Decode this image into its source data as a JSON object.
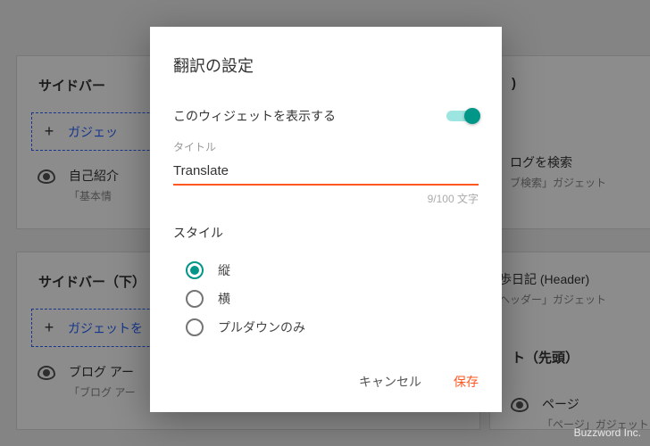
{
  "bg": {
    "left_top_title": "サイドバー",
    "left_bot_title": "サイドバー（下）",
    "add_gadget": "ガジェッ",
    "add_gadget2": "ガジェットを",
    "item1_title": "自己紹介",
    "item1_sub": "「基本情",
    "item2_title": "ブログ アー",
    "item2_sub": "「ブログ アー",
    "right_top_paren": ")",
    "right_search": "ログを検索",
    "right_search_sub": "ブ検索」ガジェット",
    "right_header": "歩日記 (Header)",
    "right_header_sub": "ヘッダー」ガジェット",
    "right_bot_title": "ト（先頭）",
    "right_page": "ページ",
    "right_page_sub": "「ページ」ガジェット"
  },
  "modal": {
    "title": "翻訳の設定",
    "show_widget": "このウィジェットを表示する",
    "field_label": "タイトル",
    "field_value": "Translate",
    "counter": "9/100 文字",
    "style_label": "スタイル",
    "opt1": "縦",
    "opt2": "横",
    "opt3": "プルダウンのみ",
    "cancel": "キャンセル",
    "save": "保存"
  },
  "copyright": "Buzzword Inc."
}
